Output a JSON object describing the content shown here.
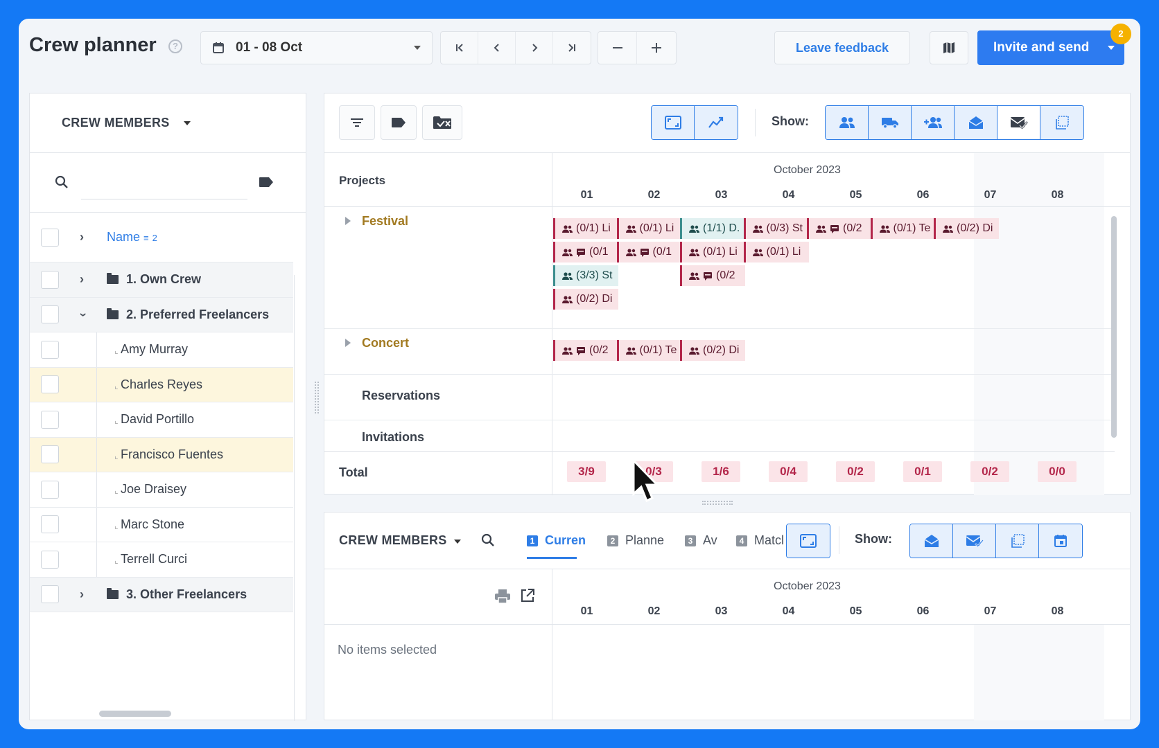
{
  "header": {
    "title": "Crew planner",
    "help": "?",
    "date_range": "01 - 08 Oct",
    "leave_feedback": "Leave feedback",
    "invite_send": "Invite and send",
    "notification_count": "2"
  },
  "left_panel": {
    "title": "CREW MEMBERS",
    "column_name": "Name",
    "sort_index": "2",
    "groups": [
      {
        "label": "1. Own Crew"
      },
      {
        "label": "2. Preferred Freelancers"
      },
      {
        "label": "3. Other Freelancers"
      }
    ],
    "members": [
      "Amy Murray",
      "Charles Reyes",
      "David Portillo",
      "Francisco Fuentes",
      "Joe Draisey",
      "Marc Stone",
      "Terrell Curci"
    ]
  },
  "planner": {
    "show_label": "Show:",
    "projects_label": "Projects",
    "month": "October 2023",
    "days": [
      "01",
      "02",
      "03",
      "04",
      "05",
      "06",
      "07",
      "08"
    ],
    "rows": {
      "festival": "Festival",
      "concert": "Concert",
      "reservations": "Reservations",
      "invitations": "Invitations"
    },
    "festival_chips": [
      "(0/1) Li",
      "(0/1) Li",
      "(1/1) D.",
      "(0/3) St",
      "(0/2",
      "(0/1) Te",
      "(0/2) Di",
      "(0/1",
      "(0/1",
      "(0/1) Li",
      "(0/1) Li",
      "(3/3) St",
      "(0/2",
      "(0/2) Di"
    ],
    "concert_chips": [
      "(0/2",
      "(0/1) Te",
      "(0/2) Di"
    ],
    "total_label": "Total",
    "totals": [
      "3/9",
      "0/3",
      "1/6",
      "0/4",
      "0/2",
      "0/1",
      "0/2",
      "0/0"
    ]
  },
  "bottom_panel": {
    "title": "CREW MEMBERS",
    "tabs": [
      {
        "num": "1",
        "label": "Curren"
      },
      {
        "num": "2",
        "label": "Planne"
      },
      {
        "num": "3",
        "label": "Av"
      },
      {
        "num": "4",
        "label": "Matcl"
      }
    ],
    "show_label": "Show:",
    "month": "October 2023",
    "days": [
      "01",
      "02",
      "03",
      "04",
      "05",
      "06",
      "07",
      "08"
    ],
    "empty_text": "No items selected"
  },
  "colors": {
    "primary": "#2d7bf0",
    "chip_bg": "#f9e3e6",
    "chip_border": "#b3264a",
    "chip_teal_bg": "#e1f1f1",
    "highlight_row": "#fdf6dd",
    "project_gold": "#a27a21"
  }
}
